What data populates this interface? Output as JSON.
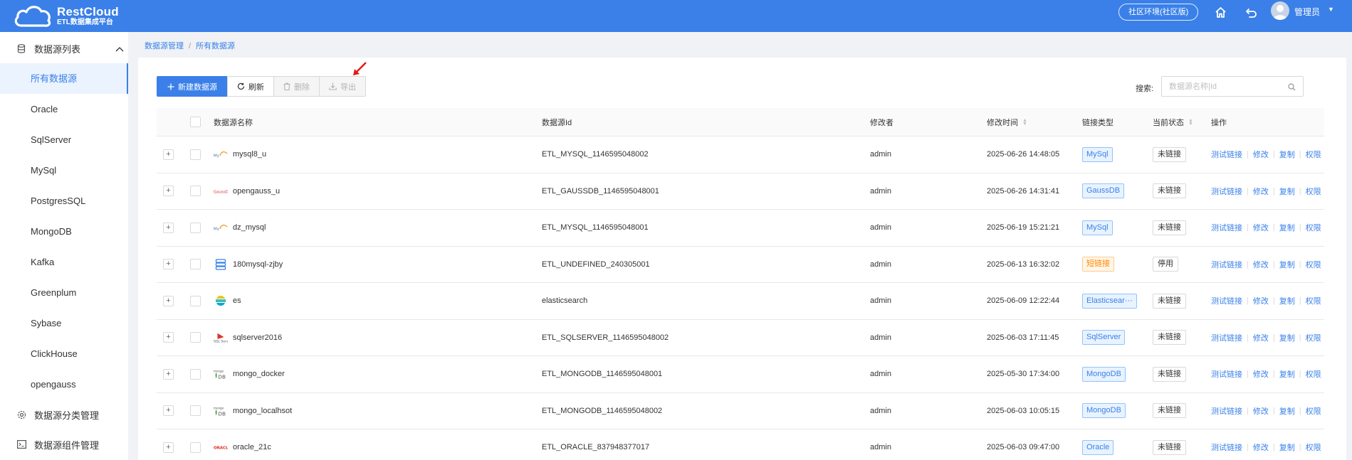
{
  "header": {
    "logo_title": "RestCloud",
    "logo_subtitle": "ETL数据集成平台",
    "env_label": "社区环境(社区版)",
    "user_name": "管理员"
  },
  "sidebar": {
    "group1_label": "数据源列表",
    "items": [
      "所有数据源",
      "Oracle",
      "SqlServer",
      "MySql",
      "PostgresSQL",
      "MongoDB",
      "Kafka",
      "Greenplum",
      "Sybase",
      "ClickHouse",
      "opengauss"
    ],
    "group2_label": "数据源分类管理",
    "group3_label": "数据源组件管理"
  },
  "breadcrumb": {
    "parent": "数据源管理",
    "current": "所有数据源"
  },
  "toolbar": {
    "new_label": "新建数据源",
    "refresh_label": "刷新",
    "delete_label": "删除",
    "export_label": "导出"
  },
  "search": {
    "label": "搜索:",
    "placeholder": "数据源名称|Id"
  },
  "table": {
    "headers": {
      "name": "数据源名称",
      "id": "数据源Id",
      "modifier": "修改者",
      "time": "修改时间",
      "type": "链接类型",
      "status": "当前状态",
      "ops": "操作"
    },
    "ops_labels": {
      "test": "测试链接",
      "edit": "修改",
      "copy": "复制",
      "perm": "权限"
    },
    "rows": [
      {
        "name": "mysql8_u",
        "id": "ETL_MYSQL_1146595048002",
        "modifier": "admin",
        "time": "2025-06-26 14:48:05",
        "type": "MySql",
        "status": "未链接",
        "icon": "mysql-icon"
      },
      {
        "name": "opengauss_u",
        "id": "ETL_GAUSSDB_1146595048001",
        "modifier": "admin",
        "time": "2025-06-26 14:31:41",
        "type": "GaussDB",
        "status": "未链接",
        "icon": "gaussdb-icon"
      },
      {
        "name": "dz_mysql",
        "id": "ETL_MYSQL_1146595048001",
        "modifier": "admin",
        "time": "2025-06-19 15:21:21",
        "type": "MySql",
        "status": "未链接",
        "icon": "mysql-icon"
      },
      {
        "name": "180mysql-zjby",
        "id": "ETL_UNDEFINED_240305001",
        "modifier": "admin",
        "time": "2025-06-13 16:32:02",
        "type": "短链接",
        "status": "停用",
        "icon": "server-icon"
      },
      {
        "name": "es",
        "id": "elasticsearch",
        "modifier": "admin",
        "time": "2025-06-09 12:22:44",
        "type": "Elasticsear···",
        "status": "未链接",
        "icon": "elasticsearch-icon"
      },
      {
        "name": "sqlserver2016",
        "id": "ETL_SQLSERVER_1146595048002",
        "modifier": "admin",
        "time": "2025-06-03 17:11:45",
        "type": "SqlServer",
        "status": "未链接",
        "icon": "sqlserver-icon"
      },
      {
        "name": "mongo_docker",
        "id": "ETL_MONGODB_1146595048001",
        "modifier": "admin",
        "time": "2025-05-30 17:34:00",
        "type": "MongoDB",
        "status": "未链接",
        "icon": "mongodb-icon"
      },
      {
        "name": "mongo_localhsot",
        "id": "ETL_MONGODB_1146595048002",
        "modifier": "admin",
        "time": "2025-06-03 10:05:15",
        "type": "MongoDB",
        "status": "未链接",
        "icon": "mongodb-icon"
      },
      {
        "name": "oracle_21c",
        "id": "ETL_ORACLE_837948377017",
        "modifier": "admin",
        "time": "2025-06-03 09:47:00",
        "type": "Oracle",
        "status": "未链接",
        "icon": "oracle-icon"
      }
    ]
  },
  "colors": {
    "primary": "#3a80e8",
    "warning": "#ff8a00"
  }
}
